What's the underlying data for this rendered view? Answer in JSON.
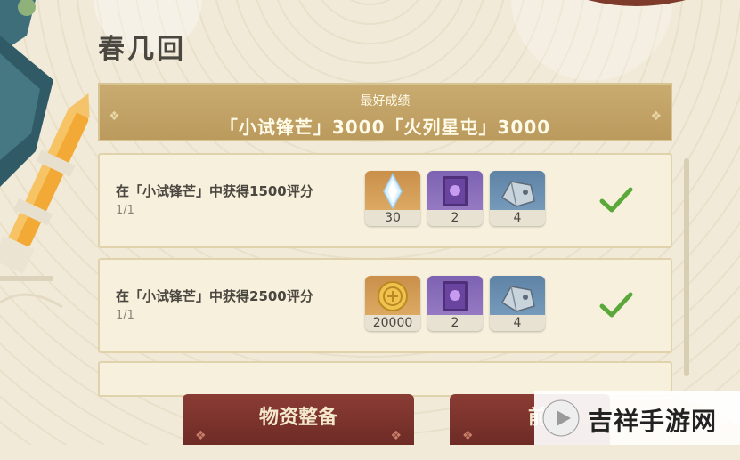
{
  "event_title": "春几回",
  "best_score": {
    "label": "最好成绩",
    "value": "「小试锋芒」3000「火列星屯」3000"
  },
  "tasks": [
    {
      "description": "在「小试锋芒」中获得1500评分",
      "progress": "1/1",
      "completed": true,
      "rewards": [
        {
          "icon": "primogem-icon",
          "count": "30",
          "color": "#d9a35e"
        },
        {
          "icon": "hero-wit-book-icon",
          "count": "2",
          "color": "#8f74c0"
        },
        {
          "icon": "mystic-ore-icon",
          "count": "4",
          "color": "#6f93b5"
        }
      ]
    },
    {
      "description": "在「小试锋芒」中获得2500评分",
      "progress": "1/1",
      "completed": true,
      "rewards": [
        {
          "icon": "mora-coin-icon",
          "count": "20000",
          "color": "#d9a35e"
        },
        {
          "icon": "hero-wit-book-icon",
          "count": "2",
          "color": "#8f74c0"
        },
        {
          "icon": "mystic-ore-icon",
          "count": "4",
          "color": "#6f93b5"
        }
      ]
    }
  ],
  "buttons": {
    "supplies": "物资整备",
    "next_partial": "前"
  },
  "watermark": {
    "text": "吉祥手游网"
  },
  "colors": {
    "check": "#5aa83a",
    "banner": "#c4a567",
    "button": "#7a322c"
  }
}
